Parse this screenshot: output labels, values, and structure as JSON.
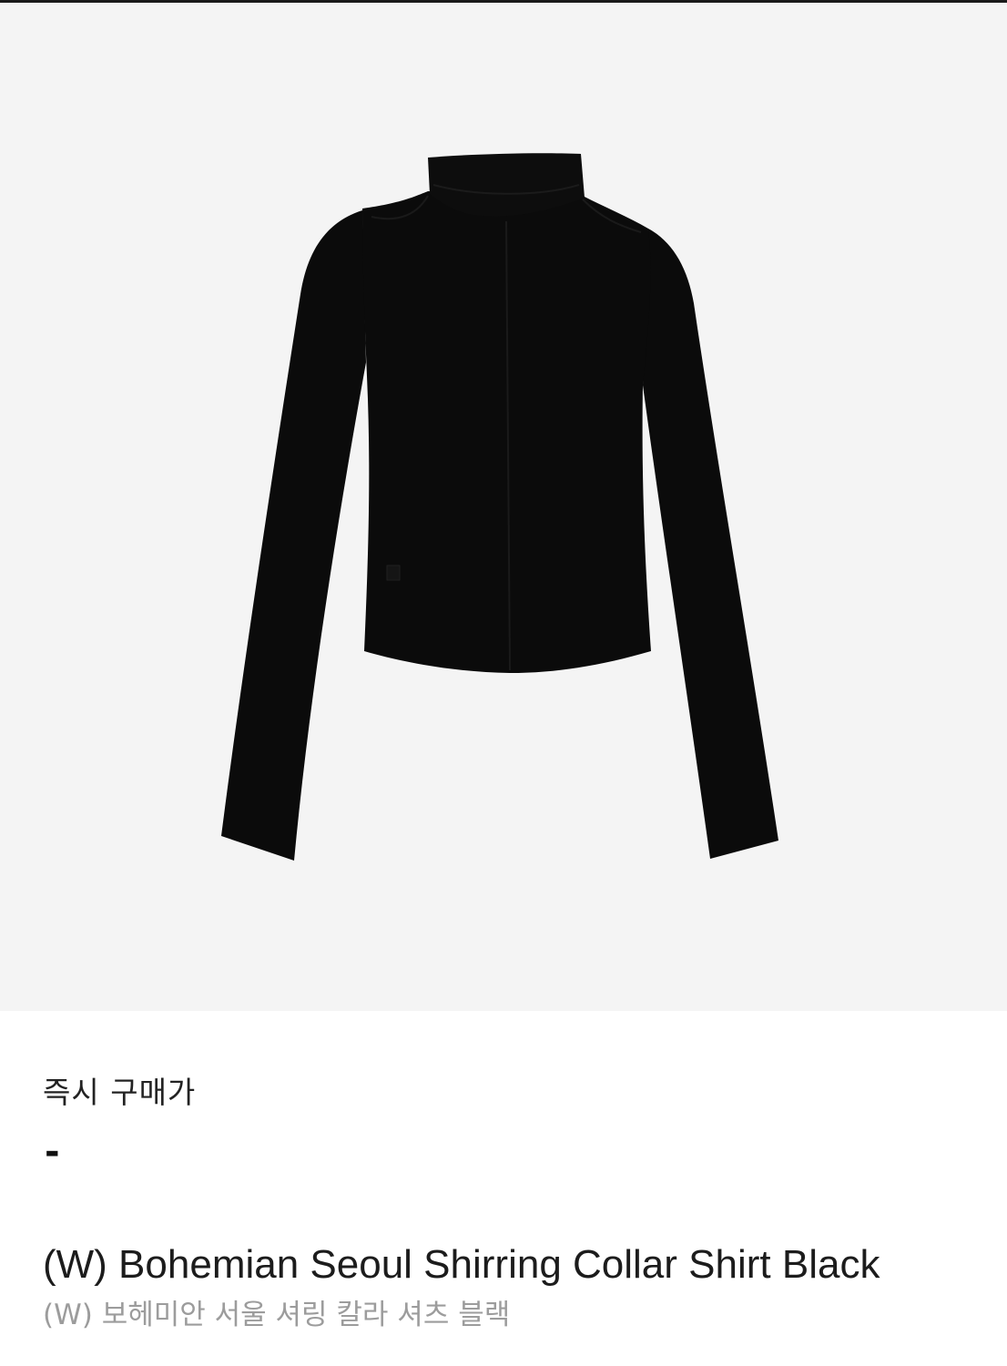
{
  "product": {
    "image_label": "(W) Bohemian Seoul Shirring Collar Shirt Black",
    "price_label": "즉시 구매가",
    "price_value": "-",
    "name_en": "(W) Bohemian Seoul Shirring Collar Shirt Black",
    "name_ko": "(W) 보헤미안 서울 셔링 칼라 셔츠 블랙"
  },
  "colors": {
    "image_background": "#f4f4f4",
    "garment": "#0b0b0b",
    "primary_text": "#1c1c1c",
    "secondary_text": "#9c9c9c"
  }
}
